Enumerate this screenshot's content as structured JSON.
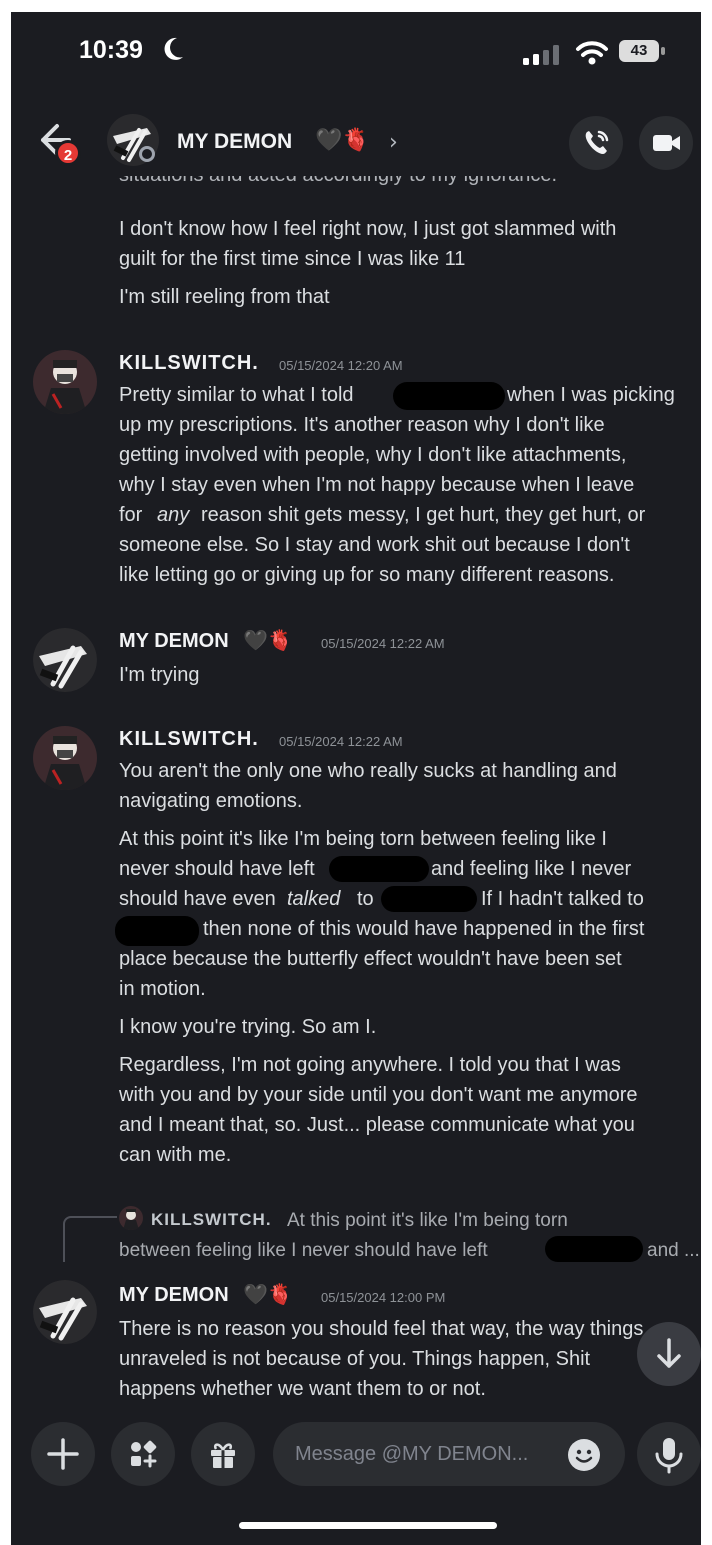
{
  "status_bar": {
    "time": "10:39",
    "moon_icon": "moon-icon",
    "battery": "43"
  },
  "header": {
    "back_badge": "2",
    "title": "MY DEMON",
    "title_decor": "🖤🫀",
    "chevron": "›",
    "call_icon": "phone-icon",
    "video_icon": "video-camera-icon"
  },
  "messages": {
    "cut_line": "situations and acted accordingly to my ignorance.",
    "m0": {
      "lines": [
        "I don't know how I feel right now, I just got slammed with",
        "guilt for the first time since I was like 11",
        "I'm still reeling from that"
      ]
    },
    "m1": {
      "author": "KILLSWITCH.",
      "timestamp": "05/15/2024 12:20 AM",
      "lines": [
        "Pretty similar to what I told",
        "when I was picking",
        "up my prescriptions. It's another reason why I don't like",
        "getting involved with people, why I don't like attachments,",
        "why I stay even when I'm not happy because when I leave",
        "for",
        "any",
        "reason shit gets messy, I get hurt, they get hurt, or",
        "someone else. So I stay and work shit out because I don't",
        "like letting go or giving up for so many different reasons."
      ]
    },
    "m2": {
      "author": "MY DEMON",
      "decor": "🖤🫀",
      "timestamp": "05/15/2024 12:22 AM",
      "lines": [
        "I'm trying"
      ]
    },
    "m3": {
      "author": "KILLSWITCH.",
      "timestamp": "05/15/2024 12:22 AM",
      "lines": [
        "You aren't the only one who really sucks at handling and",
        "navigating emotions.",
        "At this point it's like I'm being torn between feeling like I",
        "never should have left",
        "and feeling like I never",
        "should have even",
        "talked",
        "to",
        "If I hadn't talked to",
        "then none of this would have happened in the first",
        "place because the butterfly effect wouldn't have been set",
        "in motion.",
        "I know you're trying. So am I.",
        "Regardless, I'm not going anywhere. I told you that I was",
        "with you and by your side until you don't want me anymore",
        "and I meant that, so. Just... please communicate what you",
        "can with me."
      ]
    },
    "reply": {
      "author": "KILLSWITCH.",
      "text1": "At this point it's like I'm being torn",
      "text2": "between feeling like I never should have left",
      "text3": "and ..."
    },
    "m4": {
      "author": "MY DEMON",
      "decor": "🖤🫀",
      "timestamp": "05/15/2024 12:00 PM",
      "lines": [
        "There is no reason you should feel that way, the way things",
        "unraveled is not because of you. Things happen, Shit",
        "happens whether we want them to or not."
      ]
    }
  },
  "composer": {
    "add_icon": "plus-icon",
    "apps_icon": "apps-icon",
    "gift_icon": "gift-icon",
    "placeholder": "Message @MY DEMON...",
    "emoji_icon": "emoji-icon",
    "mic_icon": "microphone-icon"
  },
  "scroll_icon": "arrow-down-icon"
}
